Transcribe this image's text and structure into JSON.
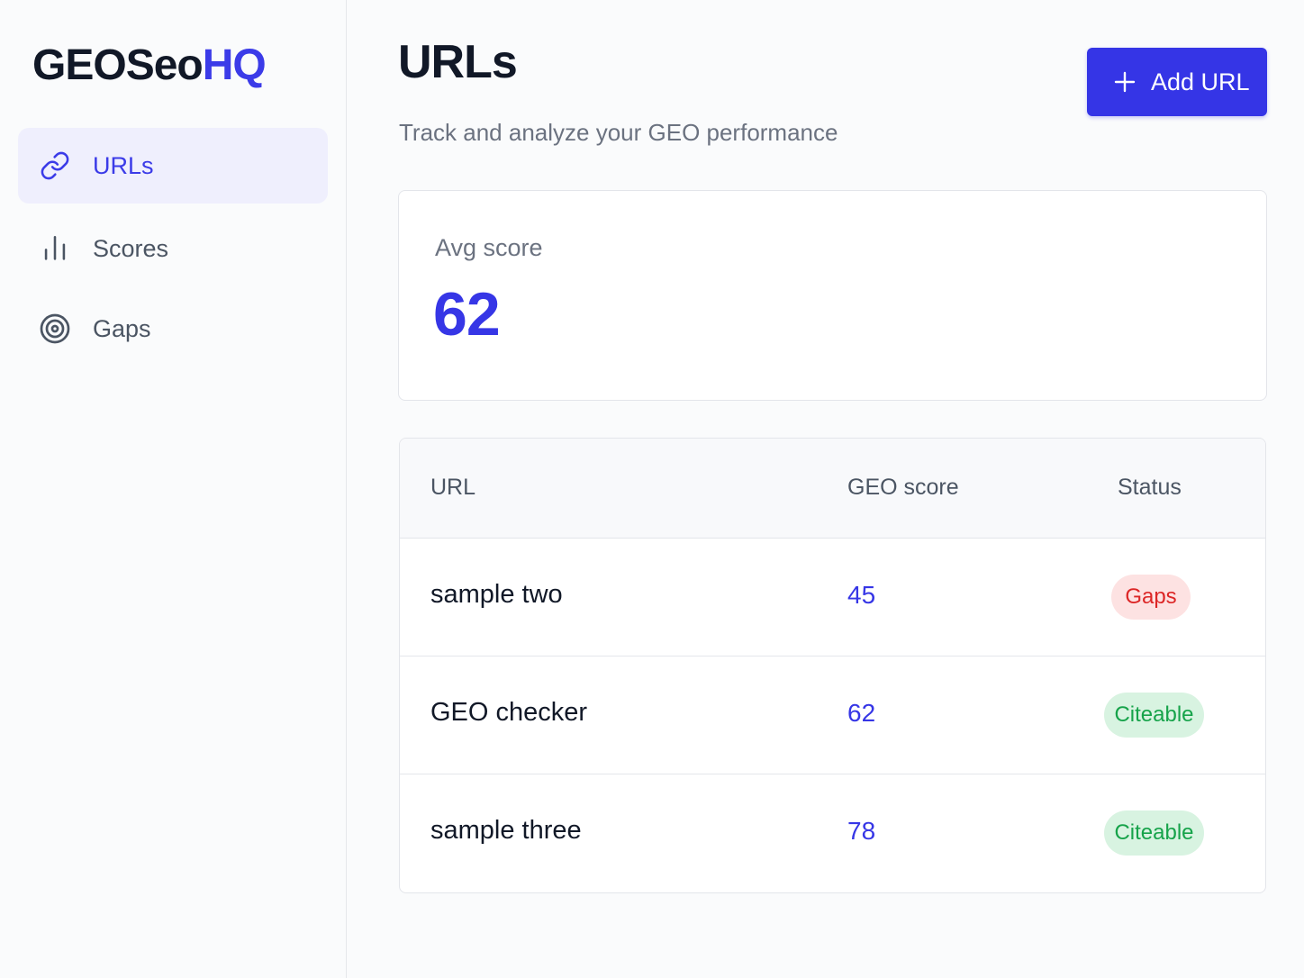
{
  "sidebar": {
    "brand": {
      "main": "GEOSeo",
      "accent": "HQ"
    },
    "items": [
      {
        "label": "URLs",
        "icon": "link-icon",
        "active": true
      },
      {
        "label": "Scores",
        "icon": "bar-chart-icon",
        "active": false
      },
      {
        "label": "Gaps",
        "icon": "target-icon",
        "active": false
      }
    ]
  },
  "header": {
    "title": "URLs",
    "subtitle": "Track and analyze your GEO performance",
    "add_button_label": "Add URL"
  },
  "stats": {
    "avg_label": "Avg score",
    "avg_value": "62"
  },
  "table": {
    "columns": [
      "URL",
      "GEO score",
      "Status"
    ],
    "rows": [
      {
        "url": "sample two",
        "score": "45",
        "status": "Gaps"
      },
      {
        "url": "GEO checker",
        "score": "62",
        "status": "Citeable"
      },
      {
        "url": "sample three",
        "score": "78",
        "status": "Citeable"
      }
    ]
  },
  "colors": {
    "accent": "#3535e6",
    "active_nav_bg": "#efeffd",
    "gaps_bg": "#fde2e2",
    "gaps_text": "#dc2626",
    "citeable_bg": "#d8f3e1",
    "citeable_text": "#16a34a"
  }
}
